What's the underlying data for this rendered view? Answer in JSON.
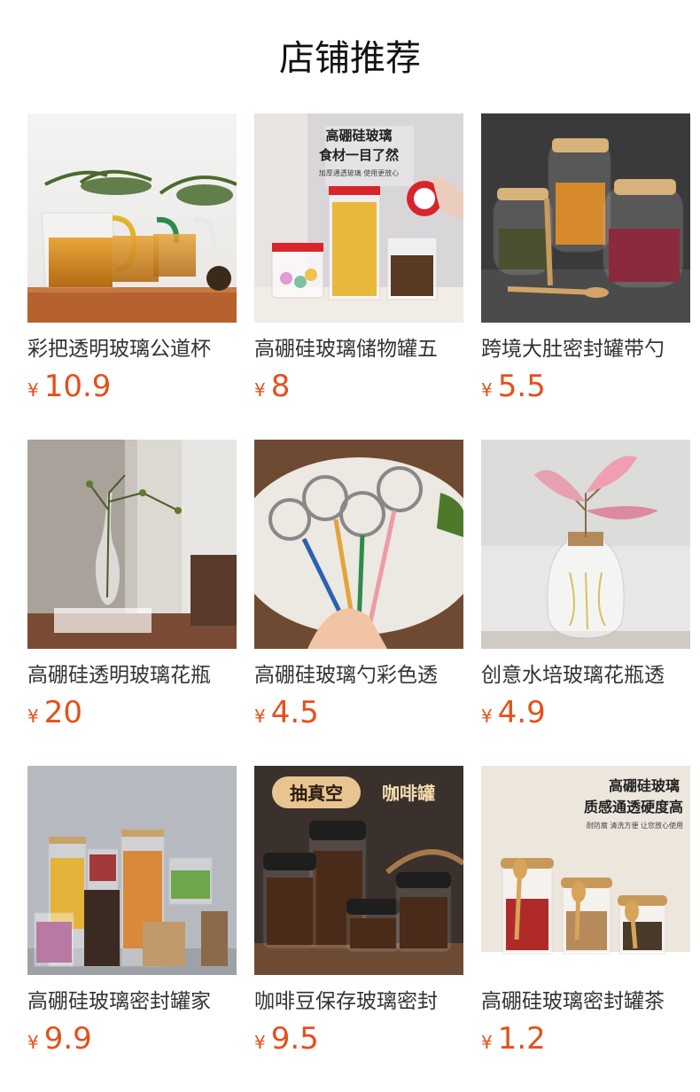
{
  "page": {
    "title": "店铺推荐"
  },
  "currency_symbol": "¥",
  "colors": {
    "price": "#e4501c"
  },
  "products": [
    {
      "name": "彩把透明玻璃公道杯",
      "price": "10.9",
      "image": "tea-pitchers-photo",
      "overlay": []
    },
    {
      "name": "高硼硅玻璃储物罐五",
      "price": "8",
      "image": "storage-jars-photo",
      "overlay": [
        "高硼硅玻璃",
        "食材一目了然",
        "加厚通透玻璃 使用更放心"
      ]
    },
    {
      "name": "跨境大肚密封罐带勺",
      "price": "5.5",
      "image": "belly-jars-photo",
      "overlay": []
    },
    {
      "name": "高硼硅透明玻璃花瓶",
      "price": "20",
      "image": "glass-vase-photo",
      "overlay": []
    },
    {
      "name": "高硼硅玻璃勺彩色透",
      "price": "4.5",
      "image": "glass-spoons-photo",
      "overlay": []
    },
    {
      "name": "创意水培玻璃花瓶透",
      "price": "4.9",
      "image": "hydroponic-vase-photo",
      "overlay": []
    },
    {
      "name": "高硼硅玻璃密封罐家",
      "price": "9.9",
      "image": "sealed-jars-photo",
      "overlay": []
    },
    {
      "name": "咖啡豆保存玻璃密封",
      "price": "9.5",
      "image": "coffee-canister-photo",
      "overlay": [
        "抽真空",
        "咖啡罐"
      ]
    },
    {
      "name": "高硼硅玻璃密封罐茶",
      "price": "1.2",
      "image": "tea-jars-photo",
      "overlay": [
        "高硼硅玻璃",
        "质感通透硬度高",
        "耐防腐 清洗方便 让您放心使用"
      ]
    }
  ]
}
